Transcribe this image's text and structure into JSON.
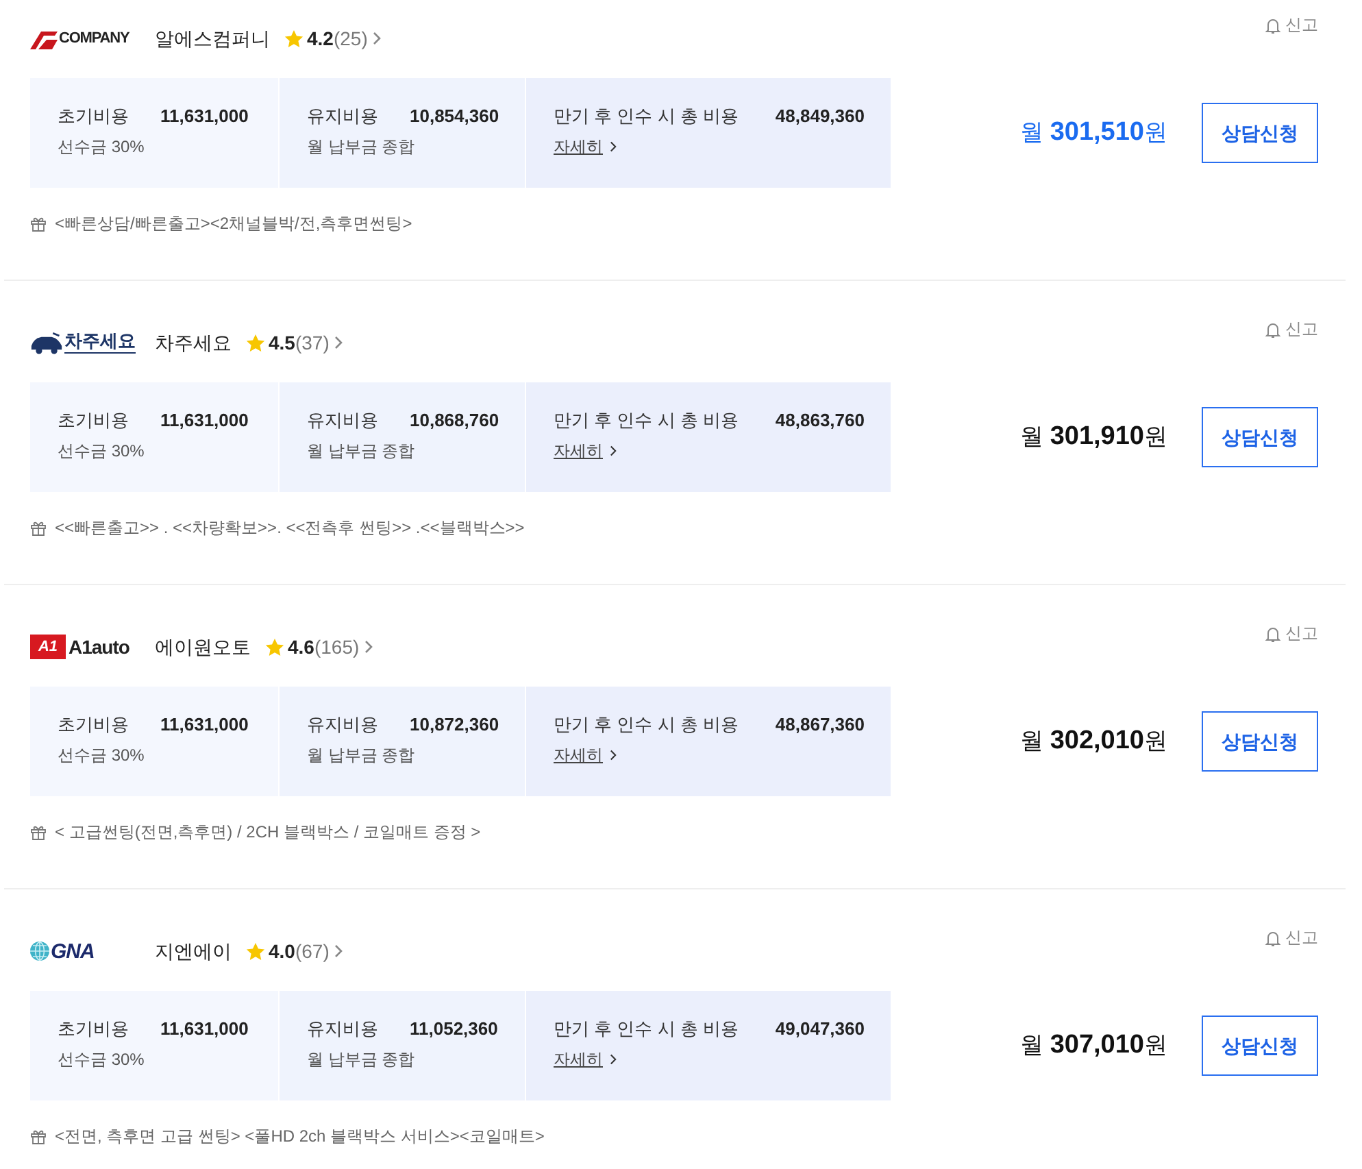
{
  "offers": [
    {
      "logo": {
        "kind": "rs",
        "wordmark": "COMPANY"
      },
      "company": "알에스컴퍼니",
      "rating": "**4.2**(25)",
      "report": "신고",
      "costs": [
        {
          "kind": "note",
          "label": "초기비용",
          "value": "11,631,000",
          "sub": "선수금 30%"
        },
        {
          "kind": "note",
          "label": "유지비용",
          "value": "10,854,360",
          "sub": "월 납부금 종합"
        },
        {
          "kind": "link",
          "label": "만기 후 인수 시 총 비용",
          "value": "48,849,360",
          "sub": "자세히"
        }
      ],
      "price": "월 **301,510**원",
      "highlighted": true,
      "button": "상담신청",
      "gift": "<빠른상담/빠른출고><2채널블박/전,측후면썬팅>"
    },
    {
      "logo": {
        "kind": "car",
        "wordmark": "차주세요"
      },
      "company": "차주세요",
      "rating": "**4.5**(37)",
      "report": "신고",
      "costs": [
        {
          "kind": "note",
          "label": "초기비용",
          "value": "11,631,000",
          "sub": "선수금 30%"
        },
        {
          "kind": "note",
          "label": "유지비용",
          "value": "10,868,760",
          "sub": "월 납부금 종합"
        },
        {
          "kind": "link",
          "label": "만기 후 인수 시 총 비용",
          "value": "48,863,760",
          "sub": "자세히"
        }
      ],
      "price": "월 **301,910**원",
      "highlighted": false,
      "button": "상담신청",
      "gift": "<<빠른출고>> . <<차량확보>>. <<전측후 썬팅>> .<<블랙박스>>"
    },
    {
      "logo": {
        "kind": "a1",
        "badge": "A1",
        "wordmark": "A1auto"
      },
      "company": "에이원오토",
      "rating": "**4.6**(165)",
      "report": "신고",
      "costs": [
        {
          "kind": "note",
          "label": "초기비용",
          "value": "11,631,000",
          "sub": "선수금 30%"
        },
        {
          "kind": "note",
          "label": "유지비용",
          "value": "10,872,360",
          "sub": "월 납부금 종합"
        },
        {
          "kind": "link",
          "label": "만기 후 인수 시 총 비용",
          "value": "48,867,360",
          "sub": "자세히"
        }
      ],
      "price": "월 **302,010**원",
      "highlighted": false,
      "button": "상담신청",
      "gift": "< 고급썬팅(전면,측후면) / 2CH 블랙박스 / 코일매트 증정 >"
    },
    {
      "logo": {
        "kind": "globe",
        "wordmark": "GNA"
      },
      "company": "지엔에이",
      "rating": "**4.0**(67)",
      "report": "신고",
      "costs": [
        {
          "kind": "note",
          "label": "초기비용",
          "value": "11,631,000",
          "sub": "선수금 30%"
        },
        {
          "kind": "note",
          "label": "유지비용",
          "value": "11,052,360",
          "sub": "월 납부금 종합"
        },
        {
          "kind": "link",
          "label": "만기 후 인수 시 총 비용",
          "value": "49,047,360",
          "sub": "자세히"
        }
      ],
      "price": "월 **307,010**원",
      "highlighted": false,
      "button": "상담신청",
      "gift": "<전면, 측후면 고급 썬팅> <풀HD 2ch 블랙박스 서비스><코일매트>"
    }
  ]
}
